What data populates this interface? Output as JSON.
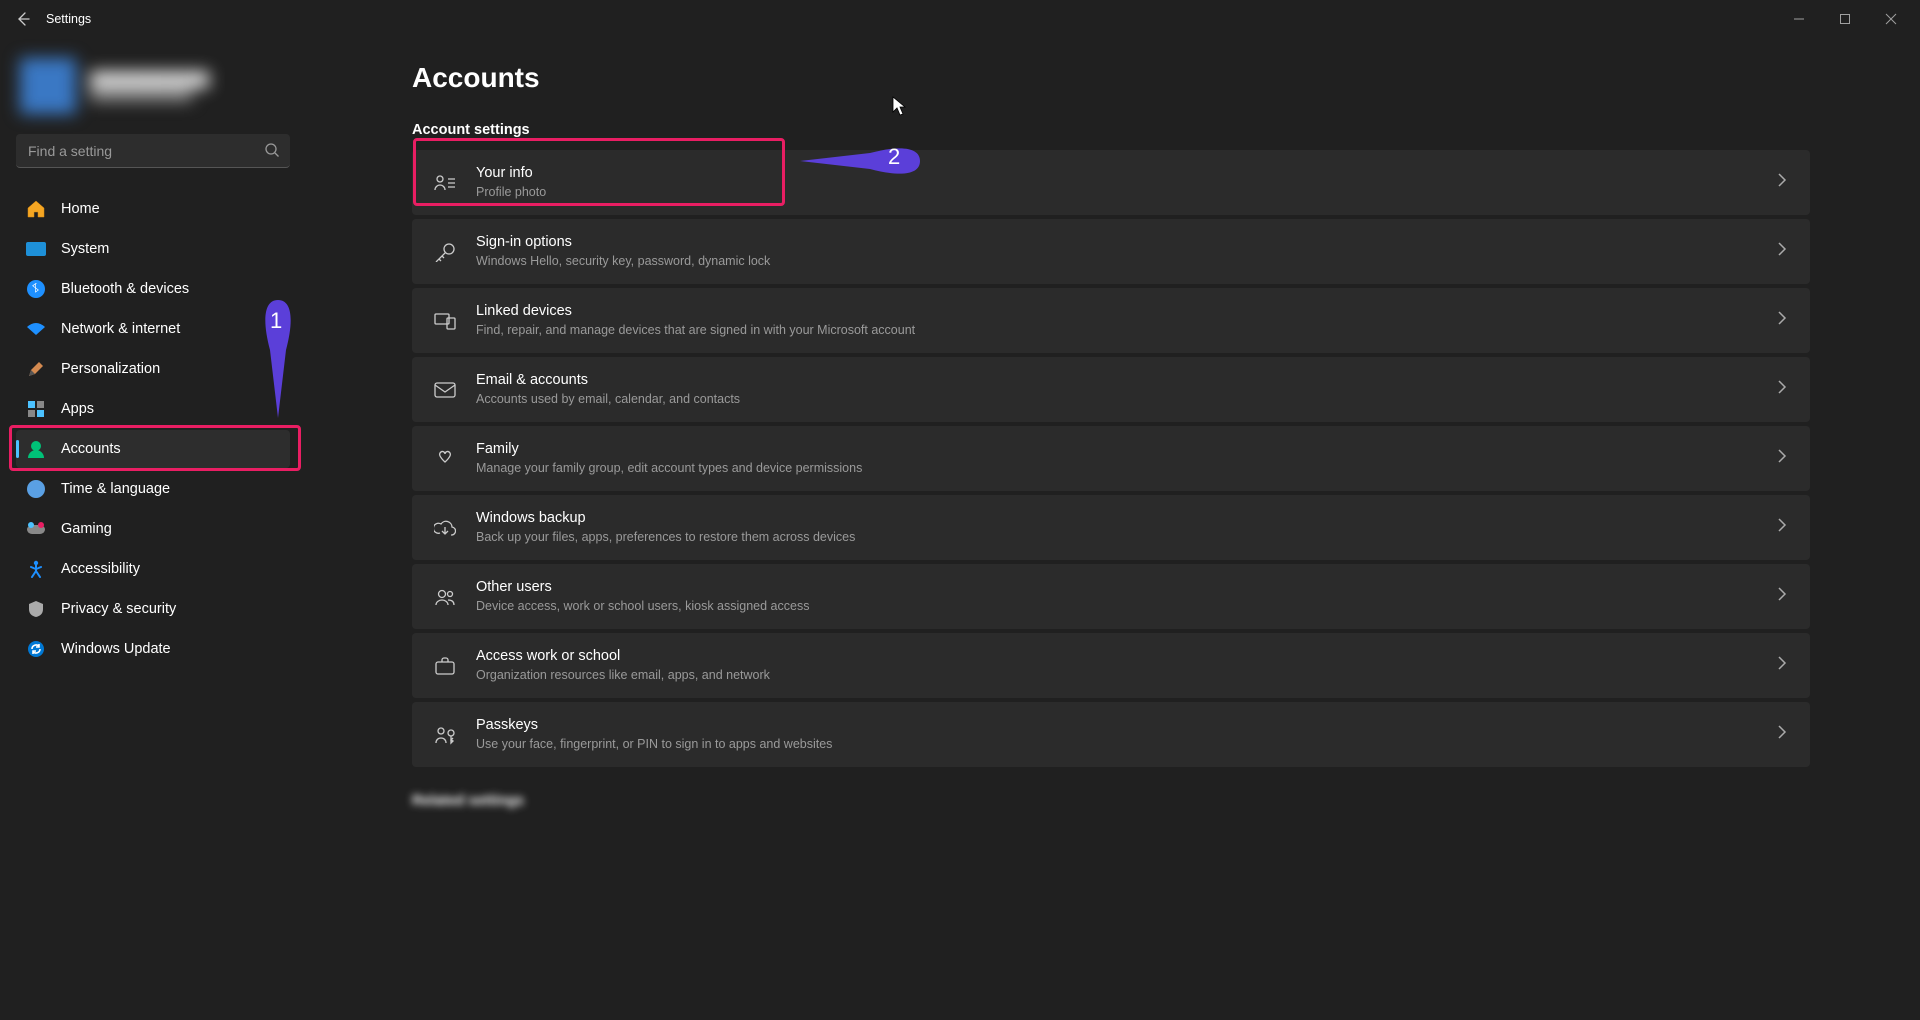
{
  "window": {
    "title": "Settings"
  },
  "profile": {
    "name": "████████████",
    "email": "████████████"
  },
  "search": {
    "placeholder": "Find a setting"
  },
  "sidebar": {
    "items": [
      {
        "label": "Home"
      },
      {
        "label": "System"
      },
      {
        "label": "Bluetooth & devices"
      },
      {
        "label": "Network & internet"
      },
      {
        "label": "Personalization"
      },
      {
        "label": "Apps"
      },
      {
        "label": "Accounts"
      },
      {
        "label": "Time & language"
      },
      {
        "label": "Gaming"
      },
      {
        "label": "Accessibility"
      },
      {
        "label": "Privacy & security"
      },
      {
        "label": "Windows Update"
      }
    ],
    "active_index": 6
  },
  "main": {
    "title": "Accounts",
    "section_label": "Account settings",
    "section_label2": "Related settings",
    "cards": [
      {
        "title": "Your info",
        "sub": "Profile photo"
      },
      {
        "title": "Sign-in options",
        "sub": "Windows Hello, security key, password, dynamic lock"
      },
      {
        "title": "Linked devices",
        "sub": "Find, repair, and manage devices that are signed in with your Microsoft account"
      },
      {
        "title": "Email & accounts",
        "sub": "Accounts used by email, calendar, and contacts"
      },
      {
        "title": "Family",
        "sub": "Manage your family group, edit account types and device permissions"
      },
      {
        "title": "Windows backup",
        "sub": "Back up your files, apps, preferences to restore them across devices"
      },
      {
        "title": "Other users",
        "sub": "Device access, work or school users, kiosk assigned access"
      },
      {
        "title": "Access work or school",
        "sub": "Organization resources like email, apps, and network"
      },
      {
        "title": "Passkeys",
        "sub": "Use your face, fingerprint, or PIN to sign in to apps and websites"
      }
    ]
  },
  "annotations": {
    "markers": [
      {
        "n": "1"
      },
      {
        "n": "2"
      }
    ]
  }
}
